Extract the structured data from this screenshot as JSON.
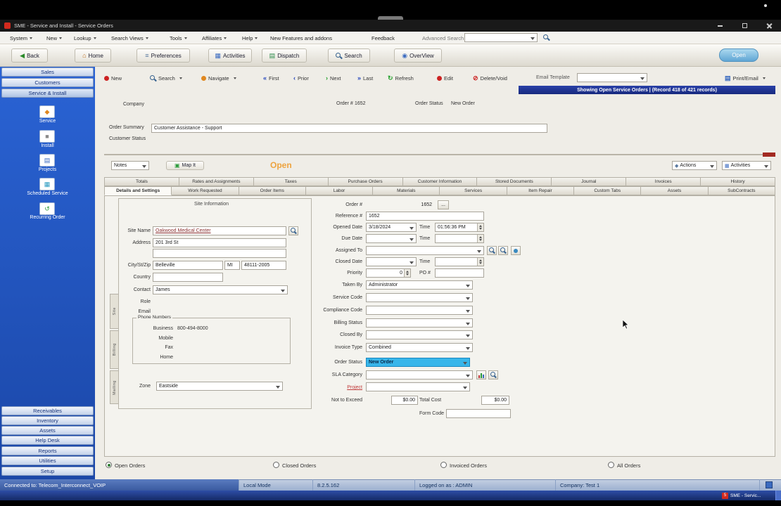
{
  "window": {
    "title": "SME - Service and Install - Service Orders"
  },
  "menu_bar": {
    "items": [
      {
        "label": "System"
      },
      {
        "label": "New"
      },
      {
        "label": "Lookup"
      },
      {
        "label": "Search Views"
      },
      {
        "label": "Tools"
      },
      {
        "label": "Affiliates"
      },
      {
        "label": "Help"
      },
      {
        "label": "New Features and addons"
      },
      {
        "label": "Feedback"
      }
    ],
    "advanced_search_label": "Advanced Search"
  },
  "main_toolbar": {
    "back": "Back",
    "home": "Home",
    "preferences": "Preferences",
    "activities": "Activities",
    "dispatch": "Dispatch",
    "search": "Search",
    "overview": "OverView",
    "open_button": "Open"
  },
  "sidebar": {
    "top_items": [
      "Sales",
      "Customers",
      "Service & Install"
    ],
    "module_items": [
      "Service",
      "Install",
      "Projects",
      "Scheduled Service",
      "Recurring Order"
    ],
    "bottom_items": [
      "Receivables",
      "Inventory",
      "Assets",
      "Help Desk",
      "Reports",
      "Utilities",
      "Setup"
    ]
  },
  "record_toolbar": {
    "new": "New",
    "search": "Search",
    "navigate": "Navigate",
    "first": "First",
    "prior": "Prior",
    "next": "Next",
    "last": "Last",
    "refresh": "Refresh",
    "edit": "Edit",
    "delete_void": "Delete/Void",
    "email_template_label": "Email Template",
    "print_email": "Print/Email"
  },
  "record_indicator": "Showing Open Service Orders  |  (Record 418 of 421 records)",
  "order_header": {
    "company_label": "Company",
    "order_number_label": "Order #",
    "order_number": "1652",
    "order_status_label": "Order Status",
    "order_status": "New Order",
    "order_summary_label": "Order Summary",
    "order_summary": "Customer Assistance - Support",
    "customer_status_label": "Customer Status"
  },
  "sub_toolbar": {
    "notes": "Notes",
    "map_it": "Map It",
    "status_text": "Open",
    "actions": "Actions",
    "activities": "Activities"
  },
  "tabs": {
    "row1": [
      "Totals",
      "Rates and Assignments",
      "Taxes",
      "Purchase Orders",
      "Customer Information",
      "Stored Documents",
      "Journal",
      "Invoices",
      "History"
    ],
    "row2": [
      "Details and Settings",
      "Work Requested",
      "Order Items",
      "Labor",
      "Materials",
      "Services",
      "Item Repair",
      "Custom Tabs",
      "Assets",
      "SubContracts"
    ],
    "active_tab": "Details and Settings"
  },
  "site_panel": {
    "heading": "Site Information",
    "side_tabs": [
      "Site",
      "Billing",
      "Mailing"
    ],
    "site_name_label": "Site Name",
    "site_name": "Oakwood Medical Center",
    "address_label": "Address",
    "address1": "201 3rd St",
    "address2": "",
    "city_label": "City/St/Zip",
    "city": "Belleville",
    "state": "MI",
    "zip": "48111-2005",
    "country_label": "Country",
    "country": "",
    "contact_label": "Contact",
    "contact": "James",
    "role_label": "Role",
    "email_label": "Email",
    "phone_heading": "Phone Numbers",
    "business_label": "Business",
    "business_phone": "800-494-8000",
    "mobile_label": "Mobile",
    "mobile_phone": "",
    "fax_label": "Fax",
    "fax_phone": "",
    "home_label": "Home",
    "home_phone": "",
    "zone_label": "Zone",
    "zone": "Eastside"
  },
  "details_panel": {
    "order_number_label": "Order #",
    "order_number": "1652",
    "reference_label": "Reference #",
    "reference": "1652",
    "opened_date_label": "Opened Date",
    "opened_date": "3/18/2024",
    "opened_time_label": "Time",
    "opened_time": "01:56:36 PM",
    "due_date_label": "Due Date",
    "due_date": "",
    "due_time_label": "Time",
    "due_time": "",
    "assigned_to_label": "Assigned To",
    "assigned_to": "",
    "closed_date_label": "Closed Date",
    "closed_date": "",
    "closed_time_label": "Time",
    "closed_time": "",
    "priority_label": "Priority",
    "priority": "0",
    "po_label": "PO #",
    "po_number": "",
    "taken_by_label": "Taken By",
    "taken_by": "Administrator",
    "service_code_label": "Service Code",
    "service_code": "",
    "compliance_code_label": "Compliance Code",
    "compliance_code": "",
    "billing_status_label": "Billing Status",
    "billing_status": "",
    "closed_by_label": "Closed By",
    "closed_by": "",
    "invoice_type_label": "Invoice Type",
    "invoice_type": "Combined",
    "order_status_label": "Order Status",
    "order_status": "New Order",
    "sla_category_label": "SLA Category",
    "sla_category": "",
    "project_label": "Project",
    "project": "",
    "not_to_exceed_label": "Not to Exceed",
    "not_to_exceed": "$0.00",
    "total_cost_label": "Total Cost",
    "total_cost": "$0.00",
    "form_code_label": "Form Code",
    "form_code": ""
  },
  "footer_filters": {
    "options": [
      "Open Orders",
      "Closed Orders",
      "Invoiced Orders",
      "All Orders"
    ],
    "selected": "Open Orders"
  },
  "status_bar": {
    "connection": "Connected to: Telecom_Interconnect_VOIP",
    "mode": "Local Mode",
    "version": "8.2.5.162",
    "logged_on": "Logged on as : ADMIN",
    "company": "Company: Test 1"
  },
  "taskbar": {
    "app": "SME - Servic..."
  },
  "colors": {
    "sidebar_blue": "#2257cc",
    "record_bar_navy": "#1c2f8c",
    "order_status_highlight": "#38b6ea",
    "open_status_orange": "#eda33f",
    "site_link_maroon": "#8a3030",
    "project_link_red": "#c03a3a"
  }
}
